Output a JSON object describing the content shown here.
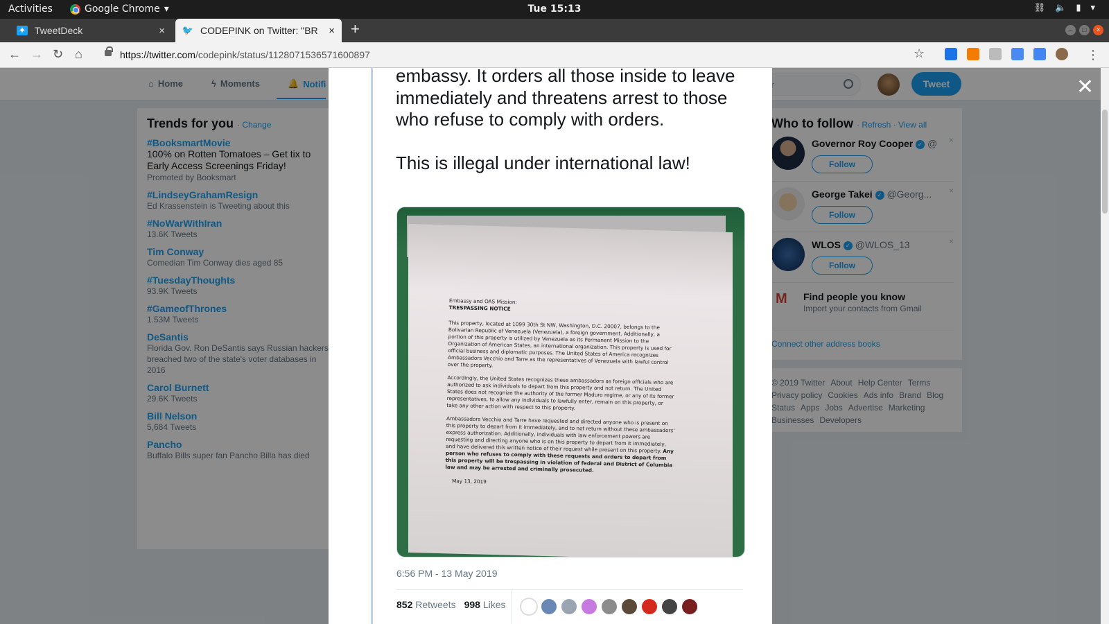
{
  "os": {
    "activities": "Activities",
    "app_name": "Google Chrome",
    "clock": "Tue 15:13"
  },
  "tabs": [
    {
      "title": "TweetDeck",
      "active": false
    },
    {
      "title": "CODEPINK on Twitter: \"BR",
      "active": true
    }
  ],
  "address_bar": {
    "url_host": "https://twitter.com",
    "url_path": "/codepink/status/1128071536571600897"
  },
  "twitter_nav": {
    "home": "Home",
    "moments": "Moments",
    "notifications": "Notifi",
    "search_placeholder": "er",
    "tweet_button": "Tweet"
  },
  "trends": {
    "title": "Trends for you",
    "change": "Change",
    "items": [
      {
        "name": "#BooksmartMovie",
        "desc": "100% on Rotten Tomatoes – Get tix to Early Access Screenings Friday!",
        "meta": "Promoted by Booksmart"
      },
      {
        "name": "#LindseyGrahamResign",
        "desc": "Ed Krassenstein is Tweeting about this"
      },
      {
        "name": "#NoWarWithIran",
        "desc": "13.6K Tweets"
      },
      {
        "name": "Tim Conway",
        "desc": "Comedian Tim Conway dies aged 85"
      },
      {
        "name": "#TuesdayThoughts",
        "desc": "93.9K Tweets"
      },
      {
        "name": "#GameofThrones",
        "desc": "1.53M Tweets"
      },
      {
        "name": "DeSantis",
        "desc": "Florida Gov. Ron DeSantis says Russian hackers breached two of the state's voter databases in 2016"
      },
      {
        "name": "Carol Burnett",
        "desc": "29.6K Tweets"
      },
      {
        "name": "Bill Nelson",
        "desc": "5,684 Tweets"
      },
      {
        "name": "Pancho",
        "desc": "Buffalo Bills super fan Pancho Billa has died"
      }
    ]
  },
  "who_to_follow": {
    "title": "Who to follow",
    "refresh": "Refresh",
    "view_all": "View all",
    "accounts": [
      {
        "name": "Governor Roy Cooper",
        "handle": "@...",
        "follow": "Follow"
      },
      {
        "name": "George Takei",
        "handle": "@Georg...",
        "follow": "Follow"
      },
      {
        "name": "WLOS",
        "handle": "@WLOS_13",
        "follow": "Follow"
      }
    ],
    "find_people": "Find people you know",
    "find_people_sub": "Import your contacts from Gmail",
    "connect": "Connect other address books"
  },
  "footer": {
    "links": [
      "© 2019 Twitter",
      "About",
      "Help Center",
      "Terms",
      "Privacy policy",
      "Cookies",
      "Ads info",
      "Brand",
      "Blog",
      "Status",
      "Apps",
      "Jobs",
      "Advertise",
      "Marketing",
      "Businesses",
      "Developers"
    ]
  },
  "tweet": {
    "text_p1": "embassy. It orders all those inside to leave immediately and threatens arrest to those who refuse to comply with orders.",
    "text_p2": "This is illegal under international law!",
    "timestamp": "6:56 PM - 13 May 2019",
    "retweets_count": "852",
    "retweets_label": "Retweets",
    "likes_count": "998",
    "likes_label": "Likes"
  },
  "notice_image": {
    "heading1": "Embassy and OAS Mission:",
    "heading2": "TRESPASSING NOTICE",
    "para1": "This property, located at 1099 30th St NW, Washington, D.C. 20007, belongs to the Bolivarian Republic of Venezuela (Venezuela), a foreign government. Additionally, a portion of this property is utilized by Venezuela as its Permanent Mission to the Organization of American States, an international organization. This property is used for official business and diplomatic purposes. The United States of America recognizes Ambassadors Vecchio and Tarre as the representatives of Venezuela with lawful control over the property.",
    "para2": "Accordingly, the United States recognizes these ambassadors as foreign officials who are authorized to ask individuals to depart from this property and not return. The United States does not recognize the authority of the former Maduro regime, or any of its former representatives, to allow any individuals to lawfully enter, remain on this property, or take any other action with respect to this property.",
    "para3": "Ambassadors Vecchio and Tarre have requested and directed anyone who is present on this property to depart from it immediately, and to not return without these ambassadors' express authorization. Additionally, individuals with law enforcement powers are requesting and directing anyone who is on this property to depart from it immediately, and have delivered this written notice of their request while present on this property.",
    "para3_bold": "Any person who refuses to comply with these requests and orders to depart from this property will be trespassing in violation of federal and District of Columbia law and may be arrested and criminally prosecuted.",
    "date": "May 13, 2019"
  },
  "colors": {
    "twitter_blue": "#1da1f2",
    "overlay": "rgba(0,0,0,0.45)",
    "ubuntu_orange": "#e95420"
  }
}
